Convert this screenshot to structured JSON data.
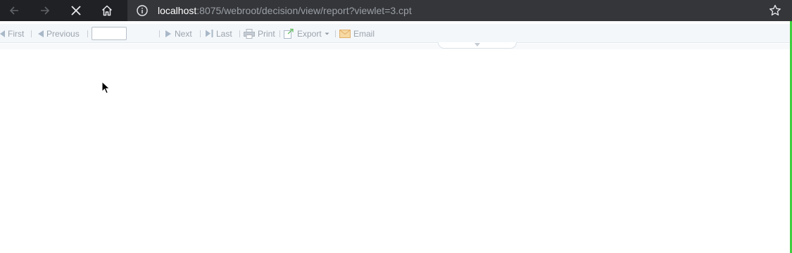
{
  "browser": {
    "url_host": "localhost",
    "url_path": ":8075/webroot/decision/view/report?viewlet=3.cpt"
  },
  "toolbar": {
    "first_label": "First",
    "previous_label": "Previous",
    "page_value": "",
    "next_label": "Next",
    "last_label": "Last",
    "print_label": "Print",
    "export_label": "Export",
    "email_label": "Email"
  },
  "colors": {
    "browser_bg": "#202124",
    "toolbar_bg": "#f4f7fa",
    "toolbar_text": "#9aa3ad",
    "accent_green": "#3fcf3f"
  }
}
